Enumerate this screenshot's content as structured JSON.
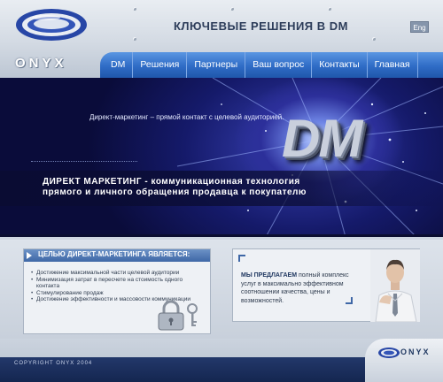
{
  "brand": {
    "logo_text": "ONYX"
  },
  "header": {
    "site_title": "КЛЮЧЕВЫЕ РЕШЕНИЯ В DM",
    "lang_label": "Eng"
  },
  "nav": {
    "items": [
      {
        "label": "DM"
      },
      {
        "label": "Решения"
      },
      {
        "label": "Партнеры"
      },
      {
        "label": "Ваш вопрос"
      },
      {
        "label": "Контакты"
      },
      {
        "label": "Главная"
      }
    ]
  },
  "hero": {
    "tagline": "Директ-маркетинг – прямой контакт с целевой аудиторией.",
    "dm_text": "DM",
    "heading_line1": "ДИРЕКТ МАРКЕТИНГ - коммуникационная технология",
    "heading_line2": "прямого и личного обращения продавца к покупателю"
  },
  "goals": {
    "title": "ЦЕЛЬЮ ДИРЕКТ-МАРКЕТИНГА ЯВЛЯЕТСЯ:",
    "items": [
      "Достижение максимальной части целевой аудитории",
      "Минимизация затрат в пересчете на стоимость одного контакта",
      "Стимулирование продаж",
      "Достижение эффективности и массовости коммуникации"
    ]
  },
  "offer": {
    "strong": "МЫ ПРЕДЛАГАЕМ",
    "text": " полный комплекс услуг в максимально эффективном соотношении качества, цены и возможностей."
  },
  "footer": {
    "copyright": "COPYRIGHT ONYX 2004",
    "logo_text": "ONYX"
  }
}
